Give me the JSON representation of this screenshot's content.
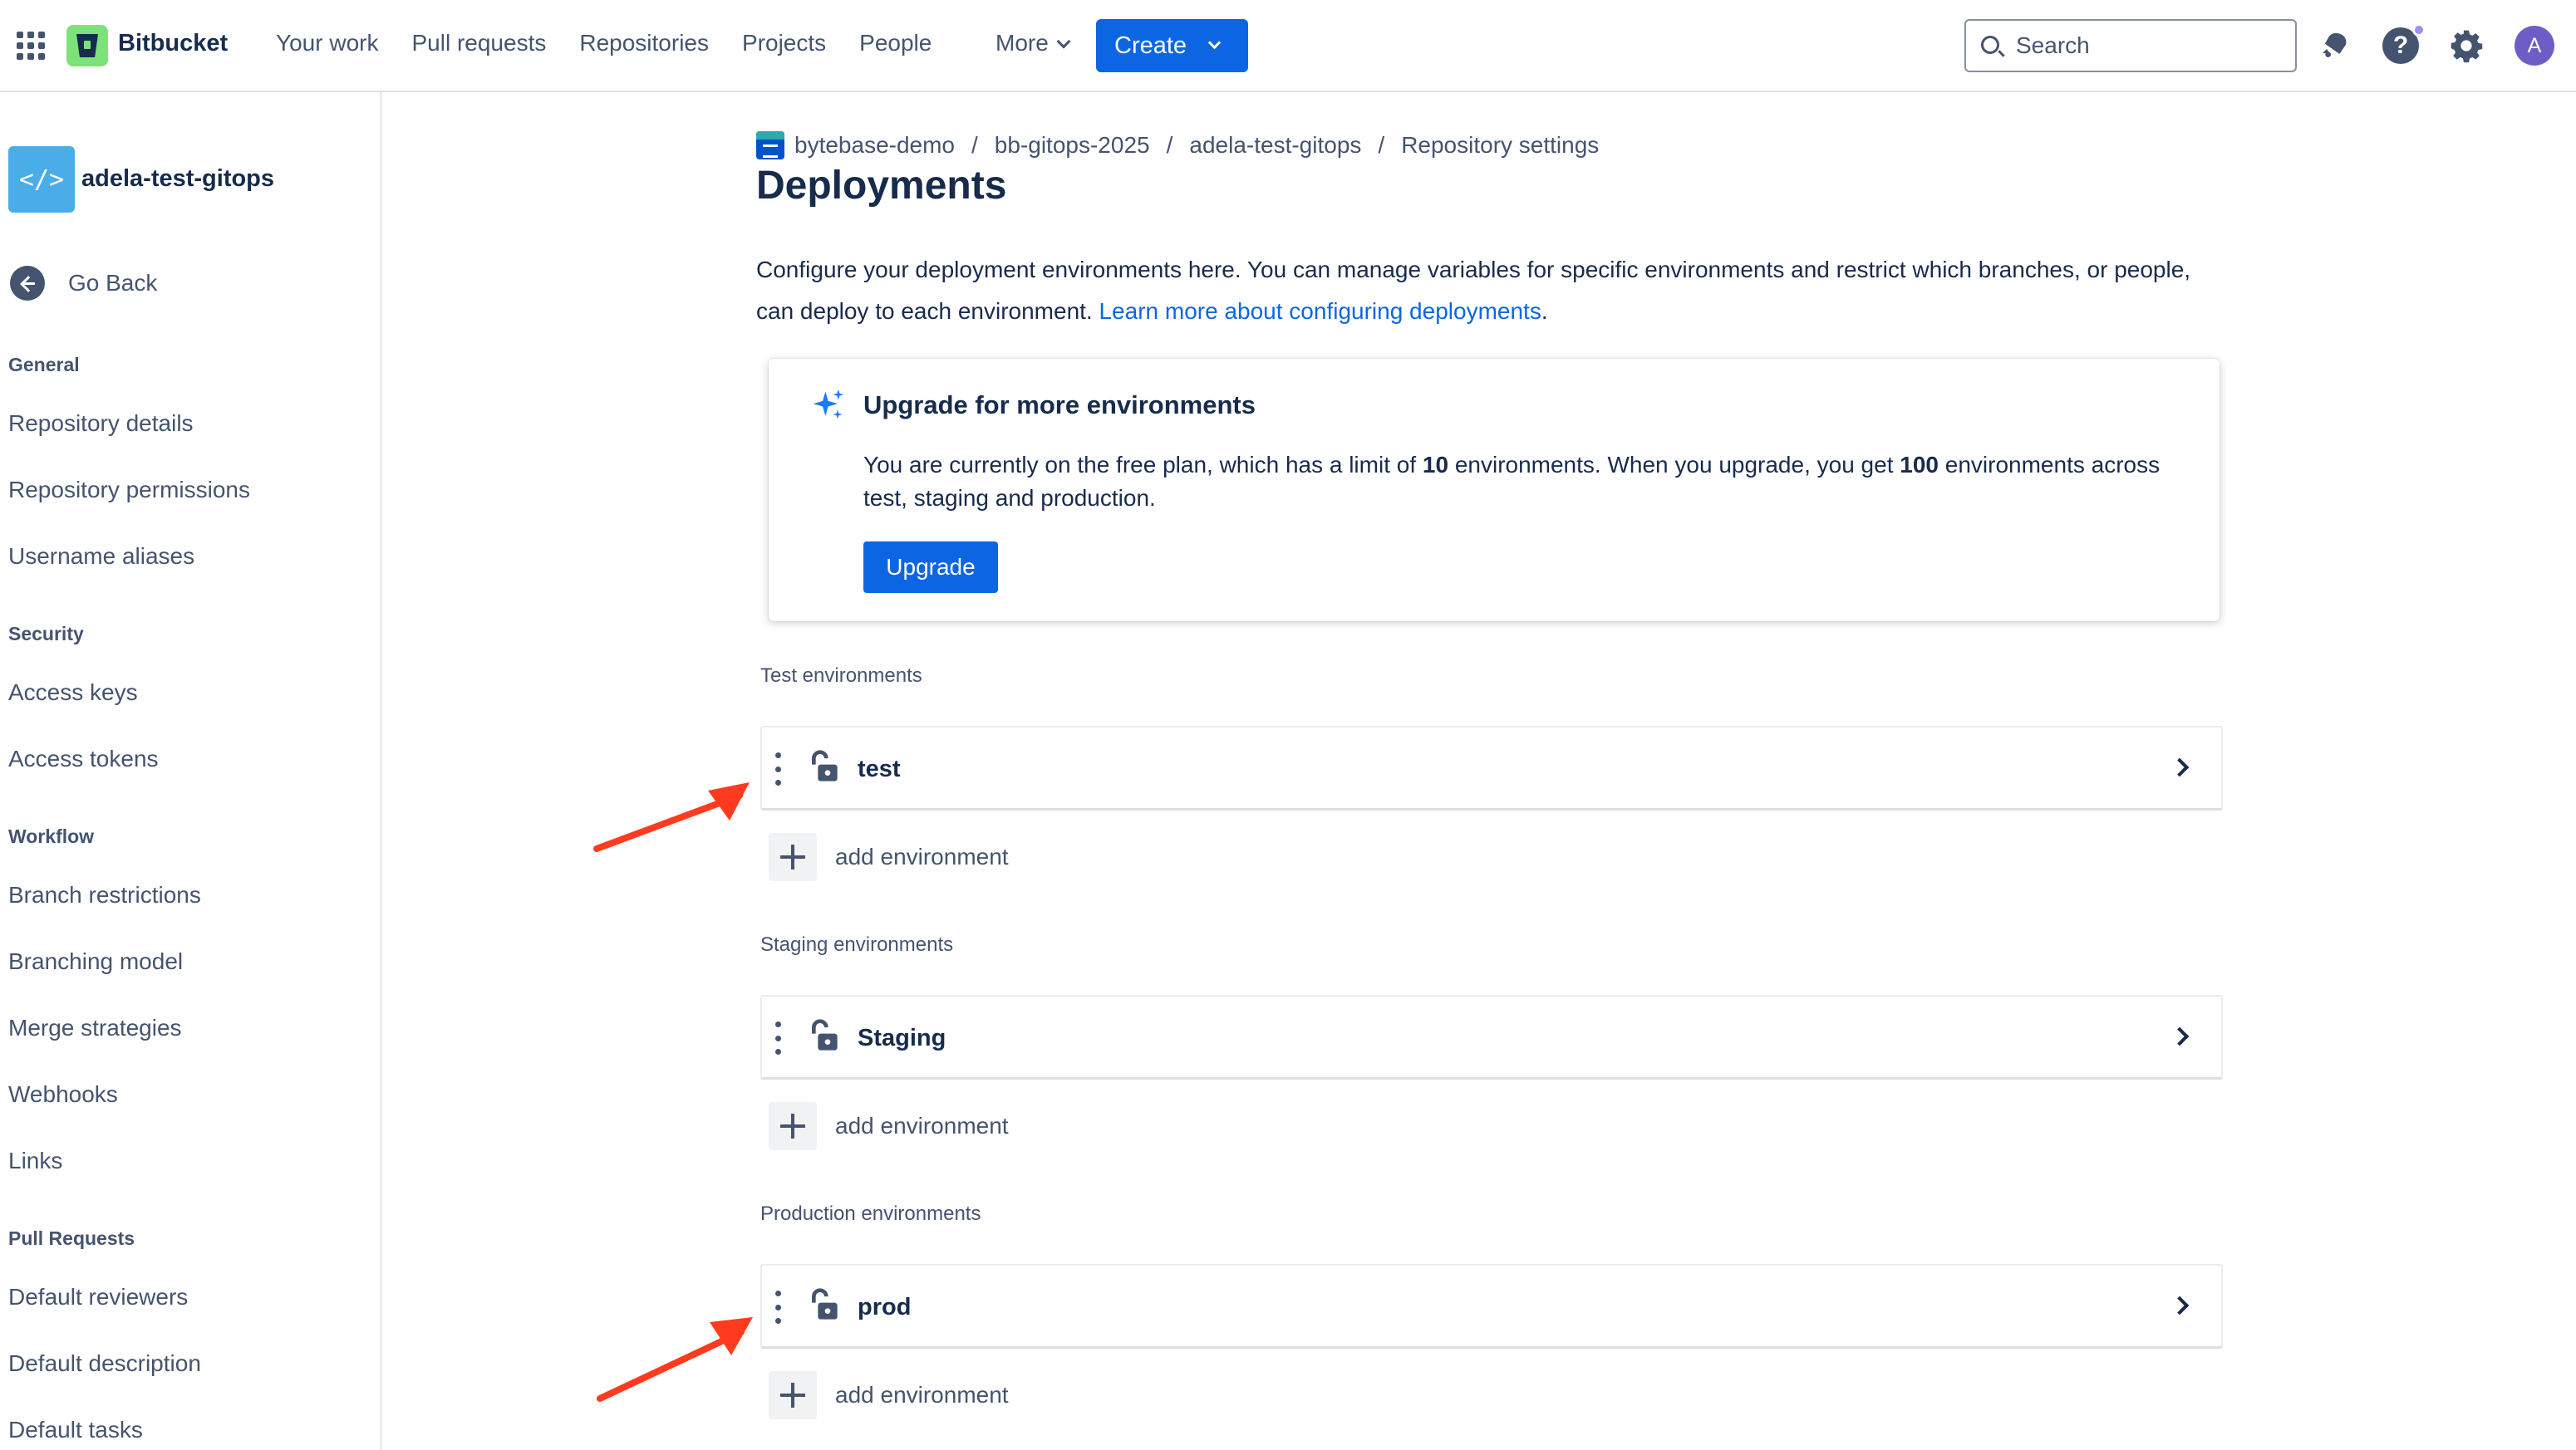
{
  "nav": {
    "logo": "Bitbucket",
    "items": [
      "Your work",
      "Pull requests",
      "Repositories",
      "Projects",
      "People"
    ],
    "more": "More",
    "create": "Create",
    "search_placeholder": "Search",
    "avatar_initial": "A"
  },
  "sidebar": {
    "repo_name": "adela-test-gitops",
    "go_back": "Go Back",
    "sections": [
      {
        "heading": "General",
        "links": [
          "Repository details",
          "Repository permissions",
          "Username aliases"
        ]
      },
      {
        "heading": "Security",
        "links": [
          "Access keys",
          "Access tokens"
        ]
      },
      {
        "heading": "Workflow",
        "links": [
          "Branch restrictions",
          "Branching model",
          "Merge strategies",
          "Webhooks",
          "Links"
        ]
      },
      {
        "heading": "Pull Requests",
        "links": [
          "Default reviewers",
          "Default description",
          "Default tasks"
        ]
      }
    ]
  },
  "breadcrumb": [
    "bytebase-demo",
    "bb-gitops-2025",
    "adela-test-gitops",
    "Repository settings"
  ],
  "page": {
    "title": "Deployments",
    "intro": "Configure your deployment environments here. You can manage variables for specific environments and restrict which branches, or people, can deploy to each environment.",
    "intro_link": "Learn more about configuring deployments",
    "intro_end": "."
  },
  "upgrade": {
    "title": "Upgrade for more environments",
    "body_1": "You are currently on the free plan, which has a limit of ",
    "limit_free": "10",
    "body_2": " environments. When you upgrade, you get ",
    "limit_paid": "100",
    "body_3": " environments across test, staging and production.",
    "button": "Upgrade"
  },
  "groups": [
    {
      "heading": "Test environments",
      "env": "test",
      "add": "add environment"
    },
    {
      "heading": "Staging environments",
      "env": "Staging",
      "add": "add environment"
    },
    {
      "heading": "Production environments",
      "env": "prod",
      "add": "add environment"
    }
  ],
  "colors": {
    "primary": "#0c66e4",
    "logo_green": "#7ee27a",
    "annotation_red": "#ff3b1f",
    "text_dark": "#172b4d",
    "text_subtle": "#44546f"
  }
}
